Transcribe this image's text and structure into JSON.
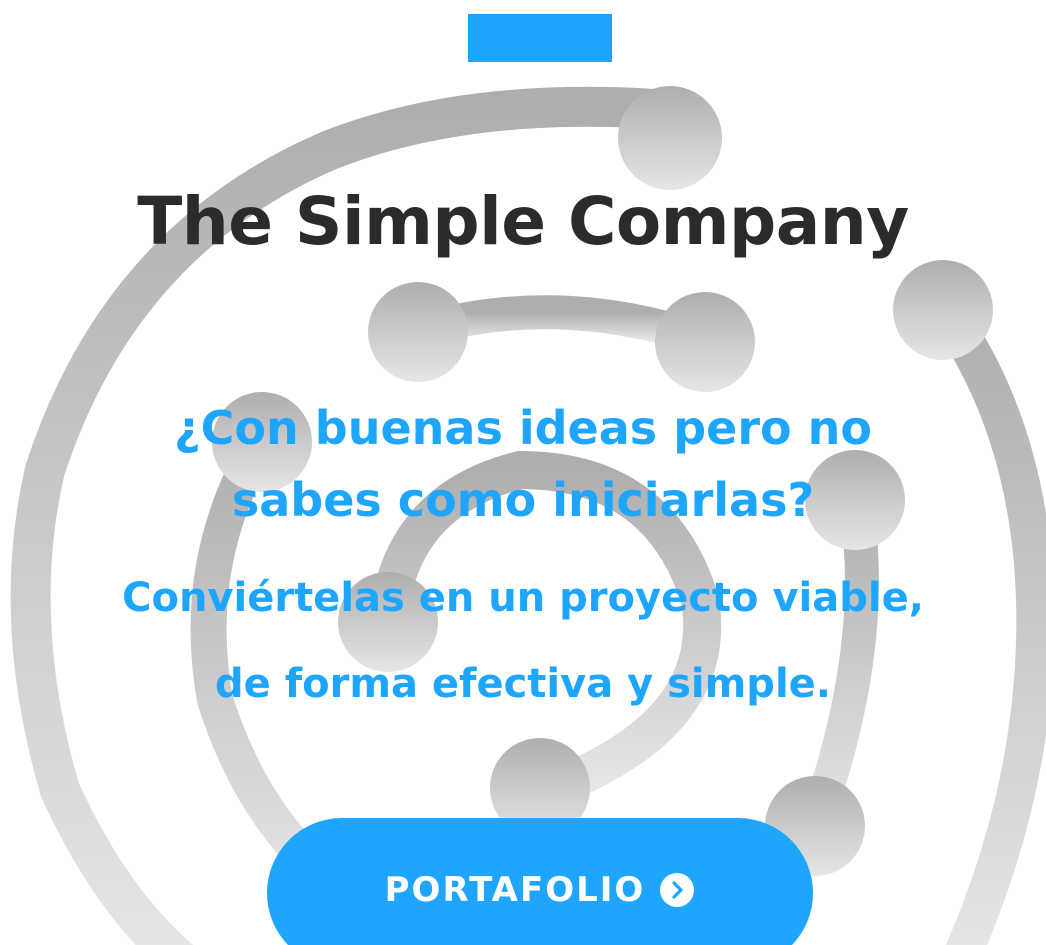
{
  "hero": {
    "title": "The Simple Company",
    "headline": "¿Con buenas ideas pero no sabes como iniciarlas?",
    "subline_1": "Conviértelas en un proyecto viable,",
    "subline_2": "de forma efectiva y simple.",
    "cta_label": "PORTAFOLIO",
    "cta_icon": "chevron-right-circle-icon"
  },
  "colors": {
    "accent": "#1ea6ff",
    "title": "#2b2b2b",
    "background_art": "#c8c8c8",
    "background": "#ffffff"
  }
}
